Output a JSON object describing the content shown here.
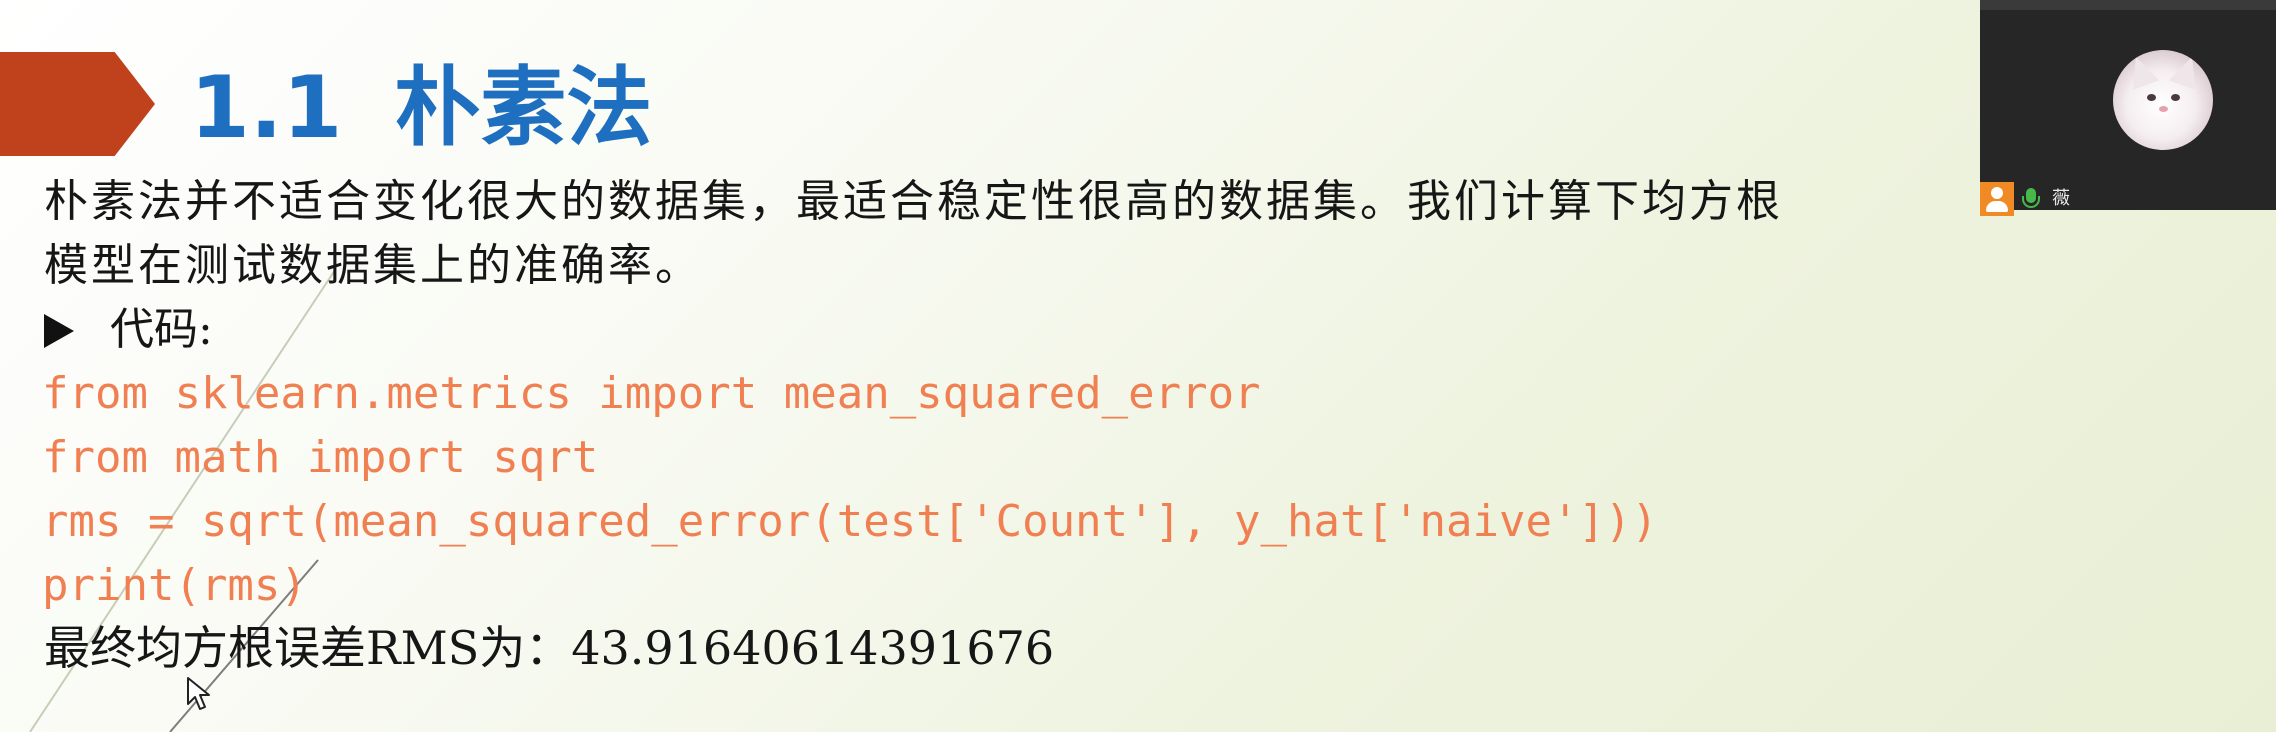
{
  "slide": {
    "title_number": "1.1",
    "title_text": "朴素法",
    "paragraph_line1": "朴素法并不适合变化很大的数据集，最适合稳定性很高的数据集。我们计算下均方根",
    "paragraph_line2": "模型在测试数据集上的准确率。",
    "bullet_label": "代码:",
    "code_lines": [
      "from sklearn.metrics import mean_squared_error",
      "from math import sqrt",
      "rms = sqrt(mean_squared_error(test['Count'], y_hat['naive']))",
      "print(rms)"
    ],
    "result_text": "最终均方根误差RMS为：43.91640614391676"
  },
  "video_panel": {
    "participant_name": "薇",
    "icons": [
      "user-icon",
      "mic-icon",
      "avatar"
    ]
  },
  "colors": {
    "title": "#1f6fc0",
    "title_arrow": "#c0421c",
    "code": "#f07f52",
    "body_text": "#161616",
    "panel_bg": "#262626",
    "user_icon": "#f08a24",
    "mic_icon": "#48b84a"
  }
}
